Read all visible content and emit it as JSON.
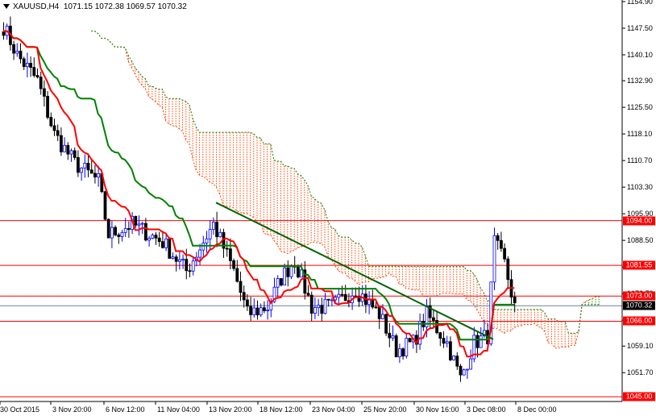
{
  "header": {
    "symbol": "XAUUSD,H4",
    "open": "1071.15",
    "high": "1072.38",
    "low": "1069.57",
    "close": "1070.32"
  },
  "colors": {
    "bull": "#0000ff",
    "bear": "#000000",
    "tenkan": "#ff0000",
    "kijun": "#008000",
    "cloud": "#ff4500",
    "cloud_alt": "#00a000",
    "level": "#ff0000",
    "current": "#708090"
  },
  "price_axis": {
    "ticks": [
      "1154.90",
      "1147.50",
      "1140.10",
      "1132.90",
      "1125.50",
      "1118.10",
      "1110.70",
      "1103.30",
      "1095.90",
      "1088.50",
      "1081.10",
      "1073.70",
      "1066.30",
      "1059.10",
      "1051.70"
    ],
    "range": [
      1045.5,
      1155
    ]
  },
  "levels": [
    {
      "label": "1094.00",
      "price": 1094.0
    },
    {
      "label": "1081.55",
      "price": 1081.55
    },
    {
      "label": "1073.00",
      "price": 1073.0
    },
    {
      "label": "1066.00",
      "price": 1066.0
    },
    {
      "label": "1045.00",
      "price": 1045.0
    }
  ],
  "current_price": {
    "label": "1070.32",
    "price": 1070.32
  },
  "time_axis": {
    "labels": [
      "30 Oct 2015",
      "3 Nov 20:00",
      "6 Nov 12:00",
      "11 Nov 04:00",
      "13 Nov 20:00",
      "18 Nov 12:00",
      "23 Nov 04:00",
      "25 Nov 20:00",
      "30 Nov 16:00",
      "3 Dec 08:00",
      "8 Dec 00:00"
    ]
  },
  "chart_data": {
    "type": "candlestick",
    "title": "XAUUSD,H4",
    "indicators": [
      "Ichimoku (Tenkan, Kijun, Cloud)",
      "Trendline"
    ],
    "price_path": [
      [
        0,
        1148
      ],
      [
        4,
        1140
      ],
      [
        10,
        1133
      ],
      [
        15,
        1118
      ],
      [
        21,
        1110
      ],
      [
        28,
        1105
      ],
      [
        31,
        1090
      ],
      [
        38,
        1093
      ],
      [
        47,
        1088
      ],
      [
        54,
        1080
      ],
      [
        62,
        1093
      ],
      [
        68,
        1080
      ],
      [
        72,
        1068
      ],
      [
        78,
        1070
      ],
      [
        82,
        1078
      ],
      [
        86,
        1083
      ],
      [
        91,
        1070
      ],
      [
        97,
        1070
      ],
      [
        104,
        1075
      ],
      [
        111,
        1068
      ],
      [
        116,
        1058
      ],
      [
        121,
        1060
      ],
      [
        125,
        1068
      ],
      [
        131,
        1060
      ],
      [
        135,
        1050
      ],
      [
        139,
        1060
      ],
      [
        143,
        1062
      ],
      [
        145,
        1088
      ],
      [
        148,
        1082
      ],
      [
        151,
        1070
      ]
    ],
    "trendline": [
      [
        1099,
        "13 Nov 20:00"
      ],
      [
        1061,
        "3 Dec 08:00"
      ]
    ]
  }
}
